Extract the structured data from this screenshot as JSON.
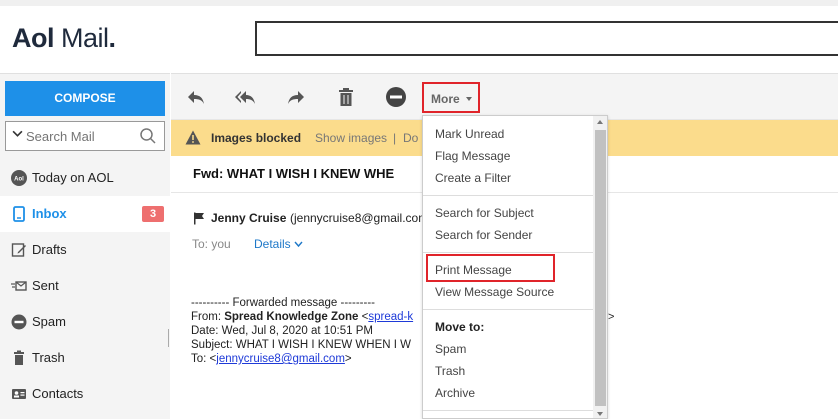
{
  "header": {
    "logo_aol": "Aol",
    "logo_mail": "Mail",
    "logo_dot": "."
  },
  "sidebar": {
    "compose_label": "COMPOSE",
    "search_placeholder": "Search Mail",
    "items": [
      {
        "label": "Today on AOL",
        "icon": "aol-icon"
      },
      {
        "label": "Inbox",
        "icon": "inbox-icon",
        "badge": "3"
      },
      {
        "label": "Drafts",
        "icon": "drafts-icon"
      },
      {
        "label": "Sent",
        "icon": "sent-icon"
      },
      {
        "label": "Spam",
        "icon": "spam-icon"
      },
      {
        "label": "Trash",
        "icon": "trash-icon"
      },
      {
        "label": "Contacts",
        "icon": "contacts-icon"
      }
    ]
  },
  "toolbar": {
    "more_label": "More"
  },
  "banner": {
    "text": "Images blocked",
    "show_images": "Show images",
    "separator": "|",
    "dont_show": "Do"
  },
  "message": {
    "subject": "Fwd: WHAT I WISH I KNEW WHE",
    "sender_name": "Jenny Cruise",
    "sender_email": "(jennycruise8@gmail.com",
    "to_label": "To: you",
    "details_label": "Details",
    "forwarded_header": "---------- Forwarded message ---------",
    "from_label": "From: ",
    "from_name": "Spread Knowledge Zone",
    "from_email_prefix": " <",
    "from_email_link": "spread-k",
    "date_line": "Date: Wed, Jul 8, 2020 at 10:51 PM",
    "subject_line": "Subject: WHAT I WISH I KNEW WHEN I W",
    "to_prefix": "To: <",
    "to_email_link": "jennycruise8@gmail.com",
    "to_suffix": ">",
    "trailing_char": ">"
  },
  "dropdown": {
    "items_group1": [
      "Mark Unread",
      "Flag Message",
      "Create a Filter"
    ],
    "items_group2": [
      "Search for Subject",
      "Search for Sender"
    ],
    "items_group3": [
      "Print Message",
      "View Message Source"
    ],
    "move_to_label": "Move to:",
    "items_group4": [
      "Spam",
      "Trash",
      "Archive"
    ]
  },
  "colors": {
    "accent": "#1e90e8",
    "badge": "#ee6f6f",
    "banner": "#fbdc8c",
    "highlight_box": "#e0242a"
  }
}
